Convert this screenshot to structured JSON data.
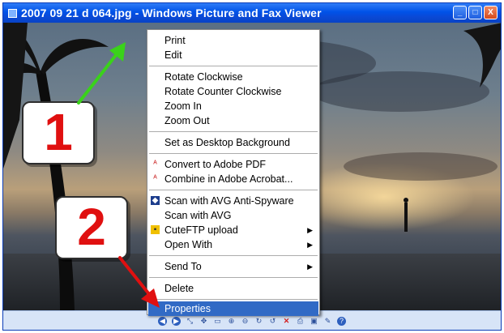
{
  "window": {
    "title": "2007 09 21 d 064.jpg - Windows Picture and Fax Viewer"
  },
  "window_buttons": [
    "_",
    "□",
    "X"
  ],
  "context_menu": {
    "items": [
      {
        "label": "Print",
        "u": "P"
      },
      {
        "label": "Edit",
        "u": "E"
      },
      {
        "label": "Rotate Clockwise"
      },
      {
        "label": "Rotate Counter Clockwise"
      },
      {
        "label": "Zoom In"
      },
      {
        "label": "Zoom Out"
      },
      {
        "label": "Set as Desktop Background"
      },
      {
        "label": "Convert to Adobe PDF",
        "icon": "adobe-pdf-icon"
      },
      {
        "label": "Combine in Adobe Acrobat...",
        "icon": "adobe-acrobat-icon"
      },
      {
        "label": "Scan with AVG Anti-Spyware",
        "icon": "avg-shield-icon"
      },
      {
        "label": "Scan with AVG"
      },
      {
        "label": "CuteFTP upload",
        "icon": "cuteftp-icon",
        "submenu": true
      },
      {
        "label": "Open With",
        "submenu": true
      },
      {
        "label": "Send To",
        "submenu": true
      },
      {
        "label": "Delete"
      },
      {
        "label": "Properties",
        "selected": true
      }
    ]
  },
  "callouts": {
    "one": "1",
    "two": "2"
  },
  "colors": {
    "menu_highlight": "#316ac5",
    "arrow_green": "#3ad21a",
    "arrow_red": "#e01010",
    "callout_text": "#e01010"
  },
  "toolbar_icons": [
    "previous-image-icon",
    "next-image-icon",
    "best-fit-icon",
    "actual-size-icon",
    "slideshow-icon",
    "zoom-in-icon",
    "zoom-out-icon",
    "rotate-clockwise-icon",
    "rotate-counterclockwise-icon",
    "delete-icon",
    "print-icon",
    "save-icon",
    "edit-icon",
    "help-icon"
  ]
}
